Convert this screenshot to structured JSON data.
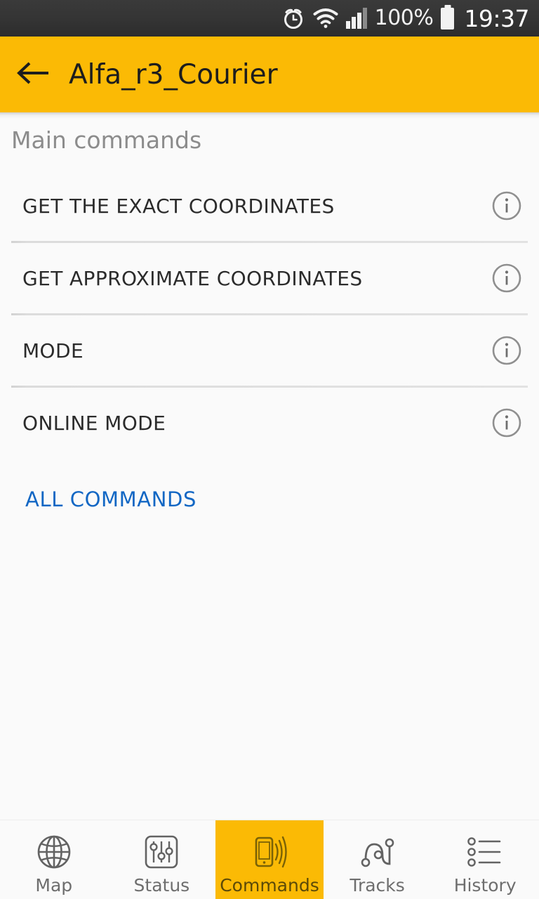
{
  "statusbar": {
    "alarm_icon": "alarm-clock-icon",
    "wifi_icon": "wifi-icon",
    "signal_icon": "signal-bars-icon",
    "battery_percent": "100%",
    "battery_icon": "battery-full-icon",
    "clock": "19:37"
  },
  "toolbar": {
    "back_icon": "back-arrow-icon",
    "title": "Alfa_r3_Courier",
    "background_color": "#FBBA05"
  },
  "content": {
    "section_header": "Main commands",
    "commands": [
      {
        "label": "GET THE EXACT COORDINATES",
        "info_icon": "info-icon"
      },
      {
        "label": "GET APPROXIMATE COORDINATES",
        "info_icon": "info-icon"
      },
      {
        "label": "MODE",
        "info_icon": "info-icon"
      },
      {
        "label": "ONLINE MODE",
        "info_icon": "info-icon"
      }
    ],
    "all_commands_link": "ALL COMMANDS",
    "link_color": "#1267c4"
  },
  "bottom_nav": {
    "active_color": "#FBBA05",
    "items": [
      {
        "label": "Map",
        "icon": "globe-icon",
        "active": false
      },
      {
        "label": "Status",
        "icon": "sliders-icon",
        "active": false
      },
      {
        "label": "Commands",
        "icon": "phone-signal-icon",
        "active": true
      },
      {
        "label": "Tracks",
        "icon": "route-icon",
        "active": false
      },
      {
        "label": "History",
        "icon": "list-icon",
        "active": false
      }
    ]
  }
}
